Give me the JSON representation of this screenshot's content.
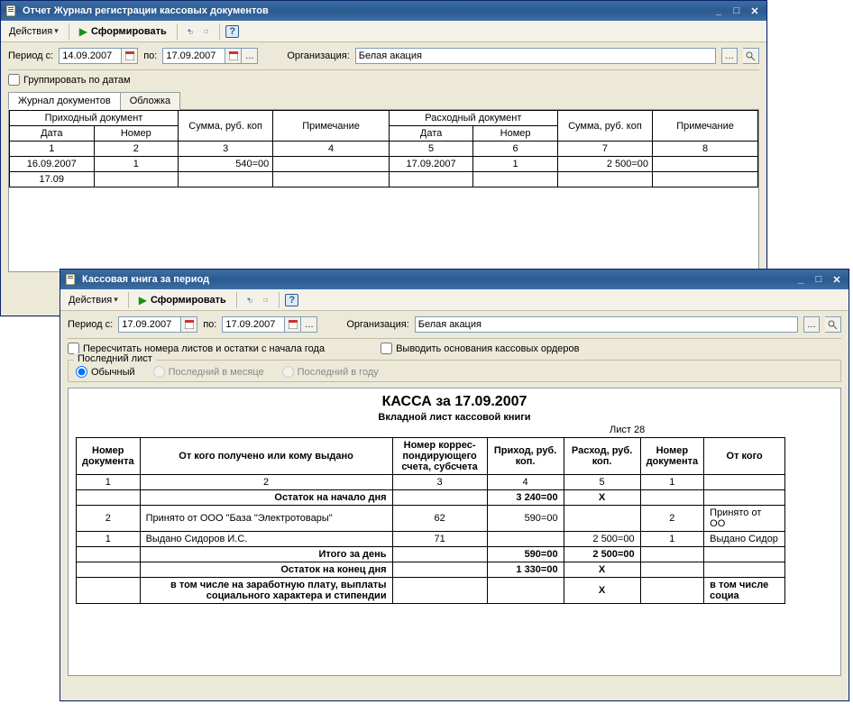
{
  "win1": {
    "title": "Отчет Журнал регистрации кассовых документов",
    "actions_label": "Действия",
    "form_label": "Сформировать",
    "period_label": "Период с:",
    "date_from": "14.09.2007",
    "date_to_label": "по:",
    "date_to": "17.09.2007",
    "org_label": "Организация:",
    "org_value": "Белая акация",
    "group_by_date_label": "Группировать по датам",
    "tab1": "Журнал документов",
    "tab2": "Обложка",
    "headers": {
      "income_doc": "Приходный документ",
      "sum": "Сумма,\nруб. коп",
      "note": "Примечание",
      "expense_doc": "Расходный документ",
      "date": "Дата",
      "number": "Номер"
    },
    "numrow": [
      "1",
      "2",
      "3",
      "4",
      "5",
      "6",
      "7",
      "8"
    ],
    "rows": [
      {
        "d1": "16.09.2007",
        "n1": "1",
        "s1": "540=00",
        "p1": "",
        "d2": "17.09.2007",
        "n2": "1",
        "s2": "2 500=00",
        "p2": ""
      },
      {
        "d1": "17.09",
        "n1": "",
        "s1": "",
        "p1": "",
        "d2": "",
        "n2": "",
        "s2": "",
        "p2": ""
      }
    ]
  },
  "win2": {
    "title": "Кассовая книга за период",
    "actions_label": "Действия",
    "form_label": "Сформировать",
    "period_label": "Период с:",
    "date_from": "17.09.2007",
    "date_to_label": "по:",
    "date_to": "17.09.2007",
    "org_label": "Организация:",
    "org_value": "Белая акация",
    "recalc_label": "Пересчитать номера листов и остатки с начала года",
    "output_basis_label": "Выводить основания кассовых ордеров",
    "last_sheet_label": "Последний лист",
    "radio_normal": "Обычный",
    "radio_month": "Последний в месяце",
    "radio_year": "Последний в году",
    "report_title": "КАССА за 17.09.2007",
    "report_sub": "Вкладной лист кассовой книги",
    "sheet_no": "Лист 28",
    "headers": {
      "doc_no": "Номер\nдокумента",
      "from_to": "От кого получено или кому выдано",
      "corr": "Номер коррес-\nпондирующего\nсчета, субсчета",
      "income": "Приход,\nруб. коп.",
      "expense": "Расход,\nруб. коп.",
      "from_to2": "От кого"
    },
    "numrow": [
      "1",
      "2",
      "3",
      "4",
      "5",
      "1",
      ""
    ],
    "opening_label": "Остаток на начало дня",
    "opening_income": "3 240=00",
    "x": "X",
    "rows": [
      {
        "no": "2",
        "txt": "Принято от ООО \"База \"Электротовары\"",
        "corr": "62",
        "inc": "590=00",
        "exp": "",
        "no2": "2",
        "txt2": "Принято от ОО"
      },
      {
        "no": "1",
        "txt": "Выдано Сидоров И.С.",
        "corr": "71",
        "inc": "",
        "exp": "2 500=00",
        "no2": "1",
        "txt2": "Выдано Сидор"
      }
    ],
    "total_day_label": "Итого за день",
    "total_inc": "590=00",
    "total_exp": "2 500=00",
    "closing_label": "Остаток на конец  дня",
    "closing_val": "1 330=00",
    "salary_label": "в том числе на заработную плату, выплаты\nсоциального характера и стипендии",
    "salary_label2": "в том числе\nсоциа"
  }
}
